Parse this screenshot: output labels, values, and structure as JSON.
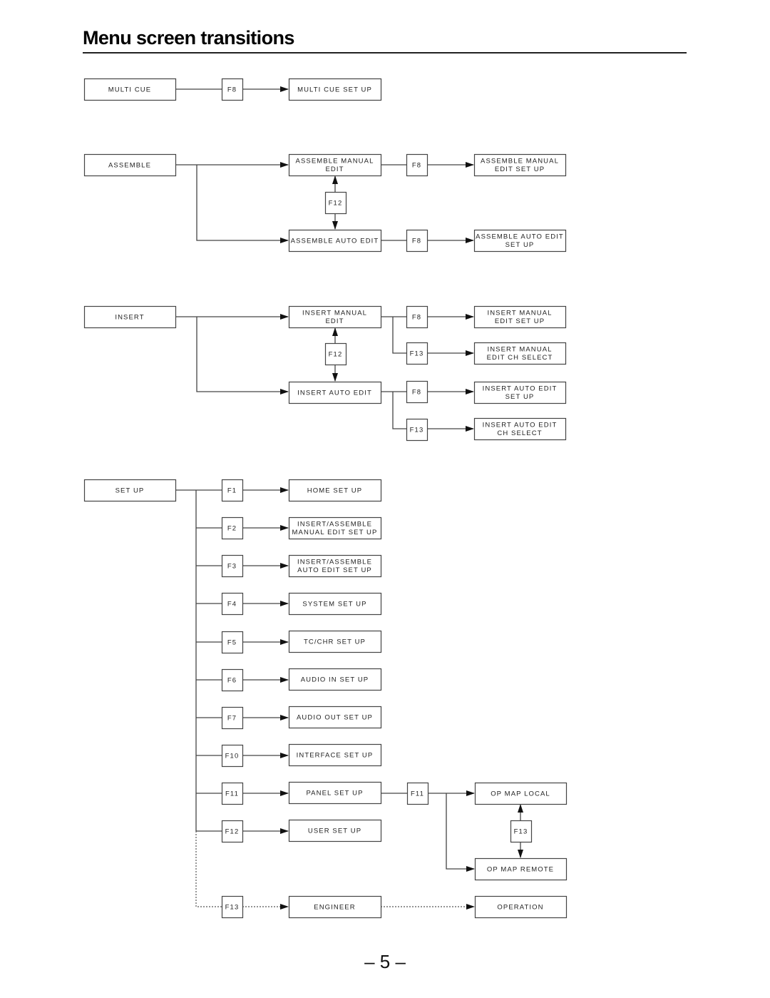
{
  "page": {
    "title": "Menu screen transitions",
    "page_number": "– 5 –"
  },
  "nodes": {
    "multi_cue": [
      "MULTI CUE"
    ],
    "multi_cue_f8": [
      "F8"
    ],
    "multi_cue_setup": [
      "MULTI CUE SET UP"
    ],
    "assemble": [
      "ASSEMBLE"
    ],
    "asm_manual": [
      "ASSEMBLE MANUAL",
      "EDIT"
    ],
    "asm_manual_f8": [
      "F8"
    ],
    "asm_manual_setup": [
      "ASSEMBLE MANUAL",
      "EDIT SET UP"
    ],
    "asm_f12": [
      "F12"
    ],
    "asm_auto": [
      "ASSEMBLE AUTO EDIT"
    ],
    "asm_auto_f8": [
      "F8"
    ],
    "asm_auto_setup": [
      "ASSEMBLE AUTO EDIT",
      "SET UP"
    ],
    "insert": [
      "INSERT"
    ],
    "ins_manual": [
      "INSERT MANUAL",
      "EDIT"
    ],
    "ins_manual_f8": [
      "F8"
    ],
    "ins_manual_setup": [
      "INSERT MANUAL",
      "EDIT SET UP"
    ],
    "ins_manual_f13": [
      "F13"
    ],
    "ins_manual_ch": [
      "INSERT MANUAL",
      "EDIT CH SELECT"
    ],
    "ins_f12": [
      "F12"
    ],
    "ins_auto": [
      "INSERT AUTO EDIT"
    ],
    "ins_auto_f8": [
      "F8"
    ],
    "ins_auto_setup": [
      "INSERT AUTO EDIT",
      "SET UP"
    ],
    "ins_auto_f13": [
      "F13"
    ],
    "ins_auto_ch": [
      "INSERT AUTO EDIT",
      "CH SELECT"
    ],
    "setup": [
      "SET UP"
    ],
    "su_f1": [
      "F1"
    ],
    "su_home": [
      "HOME SET UP"
    ],
    "su_f2": [
      "F2"
    ],
    "su_manual": [
      "INSERT/ASSEMBLE",
      "MANUAL EDIT SET UP"
    ],
    "su_f3": [
      "F3"
    ],
    "su_auto": [
      "INSERT/ASSEMBLE",
      "AUTO EDIT SET UP"
    ],
    "su_f4": [
      "F4"
    ],
    "su_system": [
      "SYSTEM SET UP"
    ],
    "su_f5": [
      "F5"
    ],
    "su_tcchr": [
      "TC/CHR SET UP"
    ],
    "su_f6": [
      "F6"
    ],
    "su_audio_in": [
      "AUDIO IN SET UP"
    ],
    "su_f7": [
      "F7"
    ],
    "su_audio_out": [
      "AUDIO OUT SET UP"
    ],
    "su_f10": [
      "F10"
    ],
    "su_interface": [
      "INTERFACE SET UP"
    ],
    "su_f11": [
      "F11"
    ],
    "su_panel": [
      "PANEL SET UP"
    ],
    "panel_f11": [
      "F11"
    ],
    "op_local": [
      "OP MAP LOCAL"
    ],
    "op_f13": [
      "F13"
    ],
    "op_remote": [
      "OP MAP REMOTE"
    ],
    "su_f12": [
      "F12"
    ],
    "su_user": [
      "USER SET UP"
    ],
    "su_f13": [
      "F13"
    ],
    "su_engineer": [
      "ENGINEER"
    ],
    "operation": [
      "OPERATION"
    ]
  }
}
